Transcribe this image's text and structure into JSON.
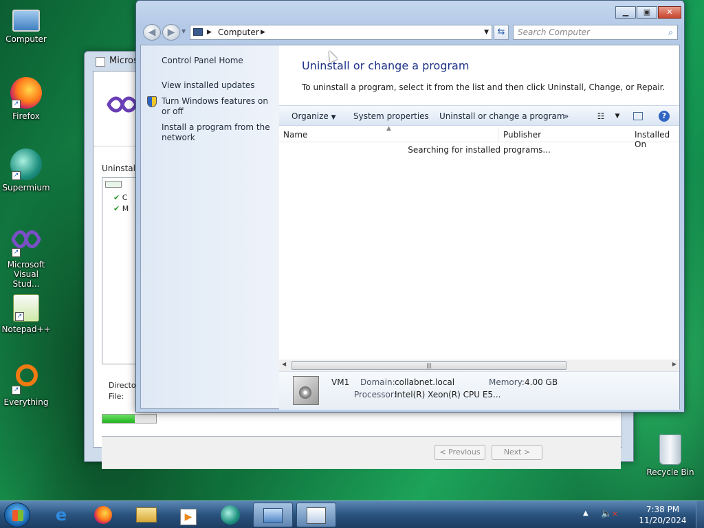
{
  "desktop": {
    "icons": [
      {
        "label": "Computer",
        "icon": "computer-icon"
      },
      {
        "label": "Firefox",
        "icon": "firefox-icon"
      },
      {
        "label": "Supermium",
        "icon": "supermium-icon"
      },
      {
        "label": "Microsoft Visual Stud...",
        "icon": "visual-studio-icon"
      },
      {
        "label": "Notepad++",
        "icon": "notepadpp-icon"
      },
      {
        "label": "Everything",
        "icon": "everything-icon"
      },
      {
        "label": "Recycle Bin",
        "icon": "recycle-bin-icon"
      }
    ]
  },
  "installer": {
    "title": "Microso",
    "section_label": "Uninstalli",
    "list_items": [
      "C",
      "M"
    ],
    "directory_label": "Directory",
    "file_label": "File:",
    "progress": 0.6,
    "previous_button": "< Previous",
    "next_button": "Next >"
  },
  "explorer": {
    "address_crumb": "Computer",
    "search_placeholder": "Search Computer",
    "left_pane": {
      "control_panel_home": "Control Panel Home",
      "view_installed_updates": "View installed updates",
      "turn_features": "Turn Windows features on or off",
      "install_from_network": "Install a program from the network"
    },
    "heading": "Uninstall or change a program",
    "description": "To uninstall a program, select it from the list and then click Uninstall, Change, or Repair.",
    "toolbar": {
      "organize": "Organize",
      "system_properties": "System properties",
      "uninstall_change": "Uninstall or change a program",
      "more": "»"
    },
    "columns": {
      "name": "Name",
      "publisher": "Publisher",
      "installed_on": "Installed On"
    },
    "status_message": "Searching for installed programs...",
    "details": {
      "computer_name": "VM1",
      "domain_label": "Domain:",
      "domain_value": "collabnet.local",
      "memory_label": "Memory:",
      "memory_value": "4.00 GB",
      "processor_label": "Processor:",
      "processor_value": "Intel(R) Xeon(R) CPU E5..."
    }
  },
  "taskbar": {
    "time": "7:38 PM",
    "date": "11/20/2024"
  }
}
